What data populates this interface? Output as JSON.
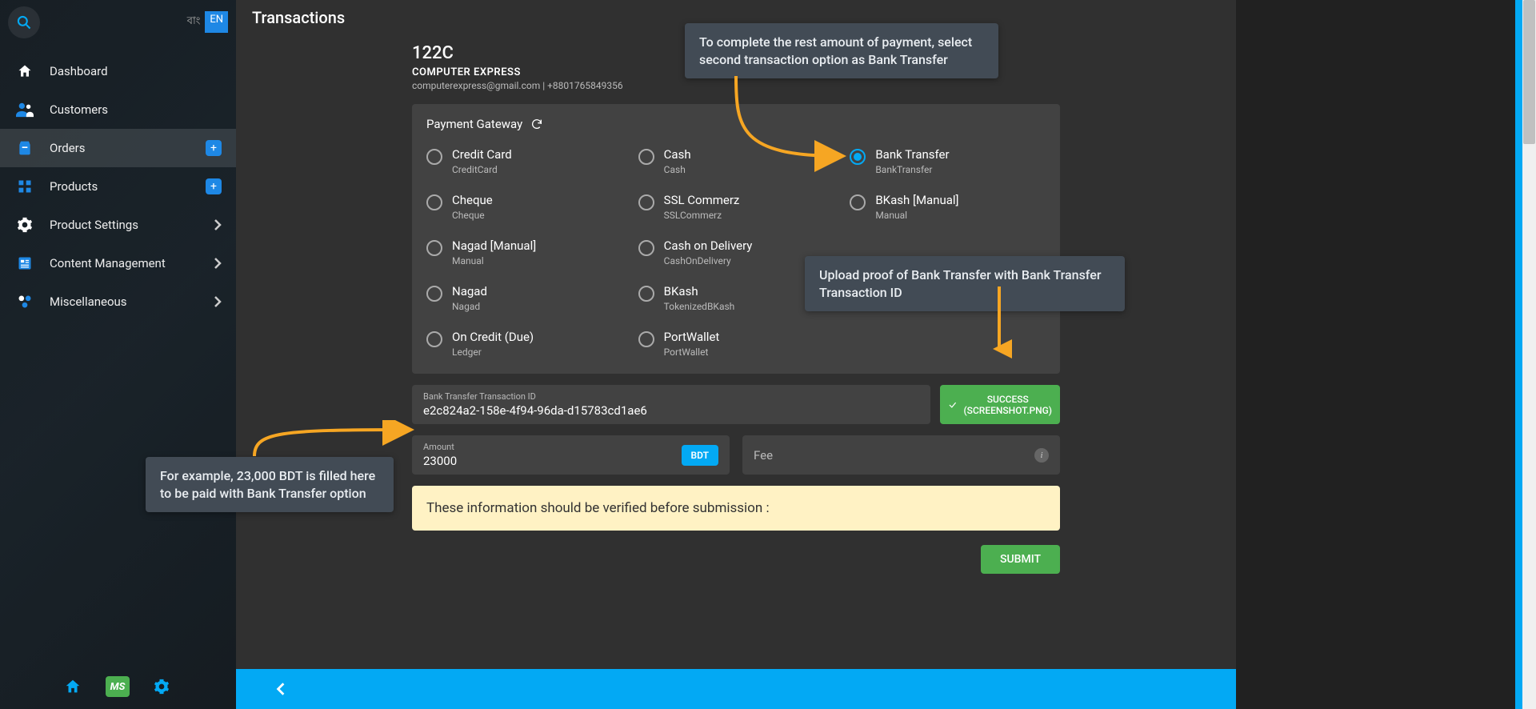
{
  "lang": {
    "bn": "বাং",
    "en": "EN"
  },
  "sidebar": {
    "items": [
      {
        "label": "Dashboard"
      },
      {
        "label": "Customers"
      },
      {
        "label": "Orders"
      },
      {
        "label": "Products"
      },
      {
        "label": "Product Settings"
      },
      {
        "label": "Content Management"
      },
      {
        "label": "Miscellaneous"
      }
    ]
  },
  "page": {
    "title": "Transactions"
  },
  "customer": {
    "id": "122C",
    "name": "COMPUTER EXPRESS",
    "contact": "computerexpress@gmail.com | +8801765849356"
  },
  "gateway": {
    "title": "Payment Gateway"
  },
  "methods": [
    {
      "title": "Credit Card",
      "sub": "CreditCard"
    },
    {
      "title": "Cash",
      "sub": "Cash"
    },
    {
      "title": "Bank Transfer",
      "sub": "BankTransfer"
    },
    {
      "title": "Cheque",
      "sub": "Cheque"
    },
    {
      "title": "SSL Commerz",
      "sub": "SSLCommerz"
    },
    {
      "title": "BKash [Manual]",
      "sub": "Manual"
    },
    {
      "title": "Nagad [Manual]",
      "sub": "Manual"
    },
    {
      "title": "Cash on Delivery",
      "sub": "CashOnDelivery"
    },
    {
      "title": "",
      "sub": ""
    },
    {
      "title": "Nagad",
      "sub": "Nagad"
    },
    {
      "title": "BKash",
      "sub": "TokenizedBKash"
    },
    {
      "title": "",
      "sub": ""
    },
    {
      "title": "On Credit (Due)",
      "sub": "Ledger"
    },
    {
      "title": "PortWallet",
      "sub": "PortWallet"
    }
  ],
  "txid": {
    "label": "Bank Transfer Transaction ID",
    "value": "e2c824a2-158e-4f94-96da-d15783cd1ae6"
  },
  "upload": {
    "label1": "SUCCESS",
    "label2": "(SCREENSHOT.PNG)"
  },
  "amount": {
    "label": "Amount",
    "value": "23000",
    "currency": "BDT"
  },
  "fee": {
    "placeholder": "Fee"
  },
  "warning": "These information should be verified before submission :",
  "submit": "SUBMIT",
  "callouts": {
    "c1": "To complete the rest amount of payment, select second transaction option as Bank Transfer",
    "c2": "Upload proof of Bank Transfer with Bank Transfer Transaction ID",
    "c3": "For example, 23,000 BDT is filled here to be paid with Bank Transfer option"
  },
  "footer_ms": "MS"
}
